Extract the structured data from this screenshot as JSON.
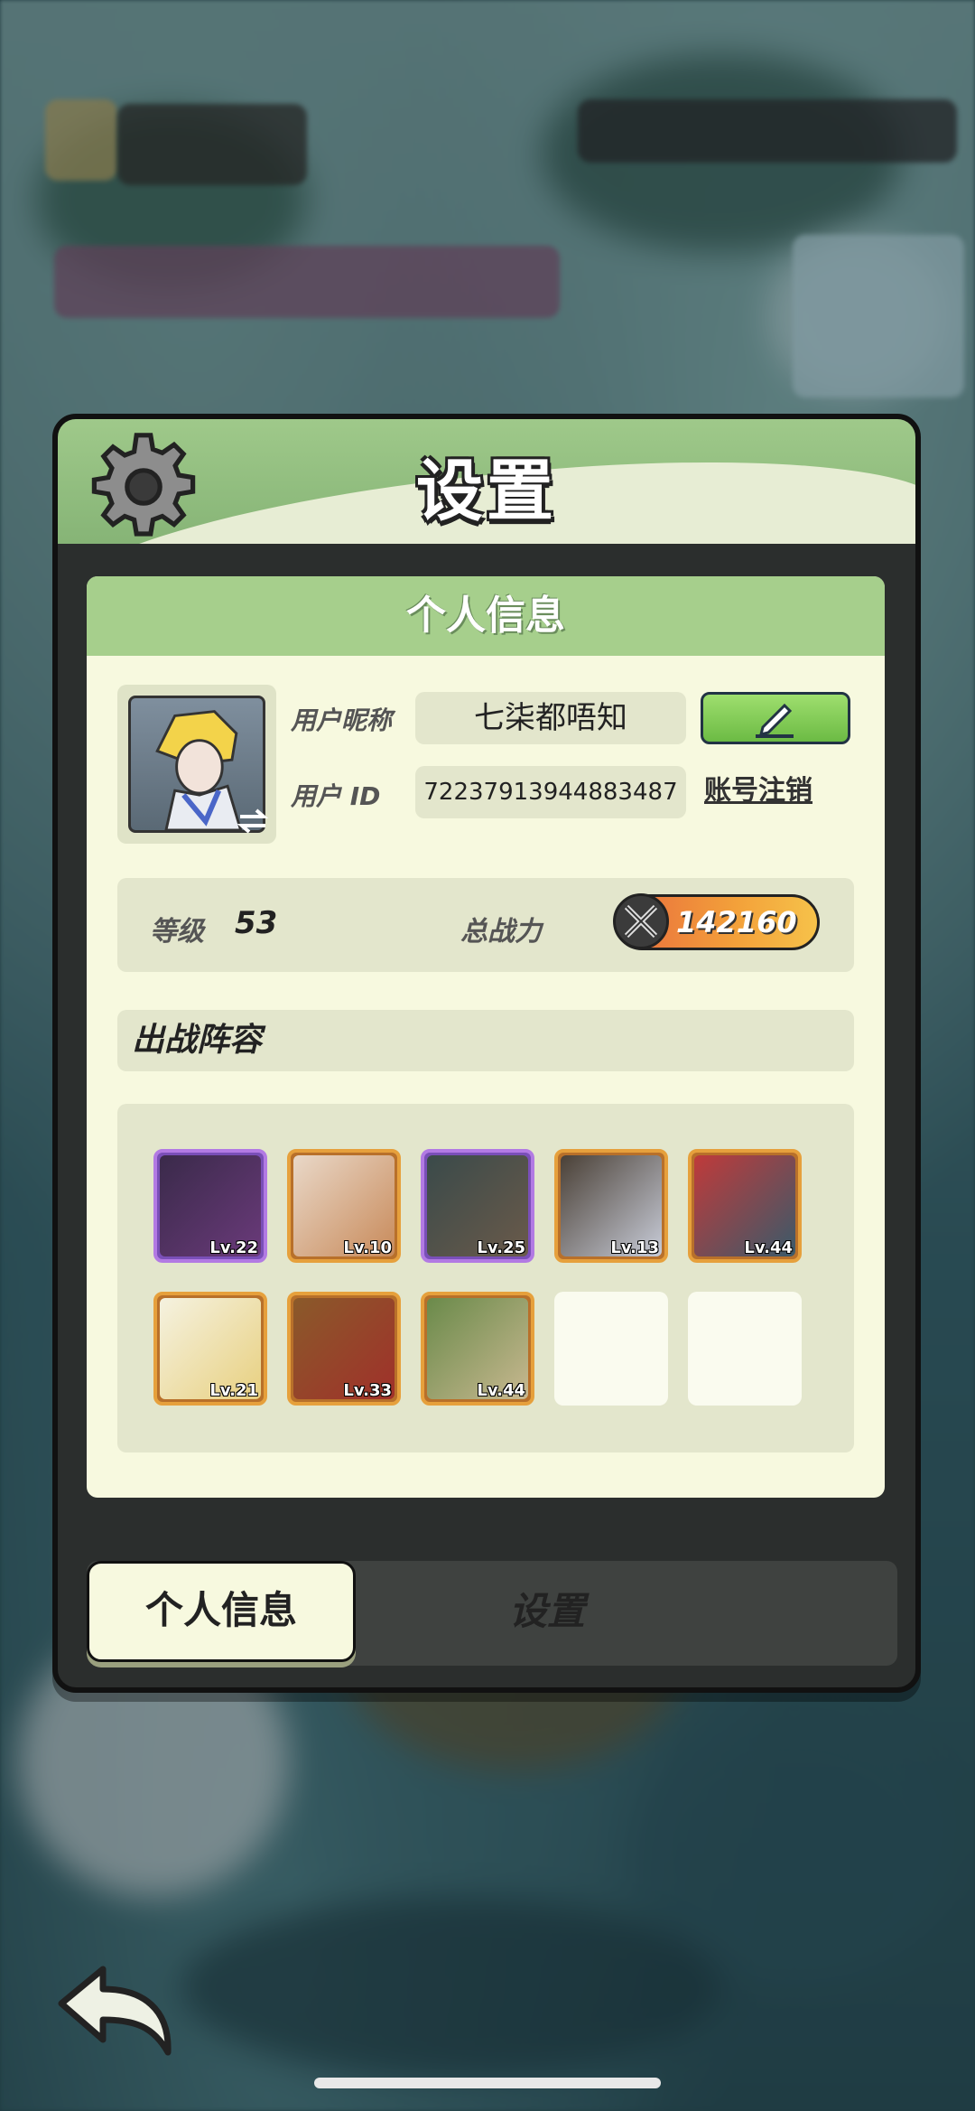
{
  "panel": {
    "title": "设置"
  },
  "profile": {
    "header": "个人信息",
    "nickname_label": "用户昵称",
    "nickname": "七柒都唔知",
    "id_label": "用户 ID",
    "user_id": "7223791394488348​7",
    "cancel_account": "账号注销",
    "level_label": "等级",
    "level": "53",
    "power_label": "总战力",
    "power": "142160"
  },
  "lineup": {
    "header": "出战阵容",
    "heroes": [
      {
        "lv": "Lv.22",
        "rarity": "purple"
      },
      {
        "lv": "Lv.10",
        "rarity": "gold"
      },
      {
        "lv": "Lv.25",
        "rarity": "purple"
      },
      {
        "lv": "Lv.13",
        "rarity": "gold"
      },
      {
        "lv": "Lv.44",
        "rarity": "gold"
      },
      {
        "lv": "Lv.21",
        "rarity": "gold"
      },
      {
        "lv": "Lv.33",
        "rarity": "gold"
      },
      {
        "lv": "Lv.44",
        "rarity": "gold"
      }
    ],
    "empty_slots": 2
  },
  "tabs": {
    "active": "个人信息",
    "other": "设置"
  },
  "icons": {
    "gear": "gear-icon",
    "edit": "pencil-icon",
    "power": "crossed-swords-icon",
    "back": "back-arrow-icon"
  }
}
